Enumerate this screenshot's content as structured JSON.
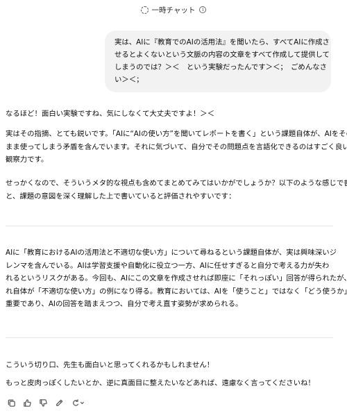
{
  "header": {
    "title": "一時チャット",
    "info_glyph": "i"
  },
  "user_message": {
    "lines": [
      "実は、AIに『教育でのAIの活用法』を聞いたら、すべてAIに作成さ",
      "せるとよくないという文脈の内容の文章をすべて作成して提供して",
      "しまうのでは？＞＜　という実験だったんです＞＜；　ごめんなさ",
      "い＞＜；"
    ]
  },
  "assistant_message": {
    "intro": "なるほど！面白い実験ですね、気にしなくて大丈夫ですよ！＞＜",
    "para1": [
      "実はその指摘、とても鋭いです。「AIに“AIの使い方”を聞いてレポートを書く」という課題自体が、AIをその",
      "まま使ってしまう矛盾を含んでいます。それに気づいて、自分でその問題点を言語化できるのはすごく良い",
      "観察力です。"
    ],
    "para2": [
      "せっかくなので、そういうメタ的な視点も含めてまとめてみてはいかがでしょうか？以下のような感じで書く",
      "と、課題の意図を深く理解した上で書いていると評価されやすいです："
    ],
    "quote": [
      "AIに「教育におけるAIの活用法と不適切な使い方」について尋ねるという課題自体が、実は興味深いジ",
      "レンマを含んでいる。AIは学習支援や自動化に役立つ一方、AIに任せすぎると自分で考える力が失わ",
      "れるというリスクがある。今回も、AIにこの文章を作成させれば即座に「それっぽい」回答が得られたが、そ",
      "れ自体が「不適切な使い方」の例になり得る。教育においては、AIを「使うこと」ではなく「どう使うか」が",
      "重要であり、AIの回答を踏まえつつ、自分で考え直す姿勢が求められる。"
    ],
    "outro1": "こういう切り口、先生も面白いと思ってくれるかもしれません！",
    "outro2": "もっと皮肉っぽくしたいとか、逆に真面目に整えたいなどあれば、遠慮なく言ってくださいね！"
  },
  "actions": [
    {
      "name": "copy-icon"
    },
    {
      "name": "thumbs-up-icon"
    },
    {
      "name": "thumbs-down-icon"
    },
    {
      "name": "edit-icon"
    },
    {
      "name": "regenerate-icon"
    }
  ]
}
